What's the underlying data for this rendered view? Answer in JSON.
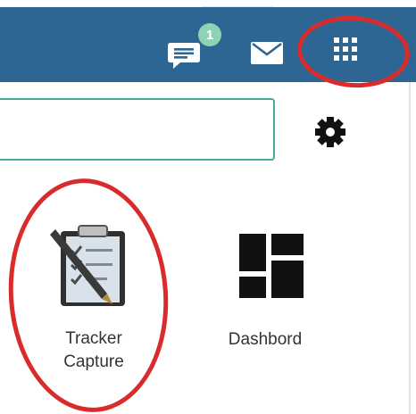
{
  "header": {
    "background_color": "#2d6593",
    "interpretations": {
      "icon": "chat-bubble-icon",
      "badge_count": "1",
      "badge_color": "#8fd2b5"
    },
    "messages": {
      "icon": "envelope-icon"
    },
    "apps_menu": {
      "icon": "apps-grid-icon"
    }
  },
  "search": {
    "value": "",
    "placeholder": "",
    "border_color": "#48a999"
  },
  "settings": {
    "icon": "gear-icon"
  },
  "apps": [
    {
      "label": "Tracker\nCapture",
      "icon": "clipboard-checklist-icon"
    },
    {
      "label": "Dashbord",
      "icon": "dashboard-tiles-icon"
    }
  ],
  "annotations": {
    "color": "#d92b2b"
  }
}
